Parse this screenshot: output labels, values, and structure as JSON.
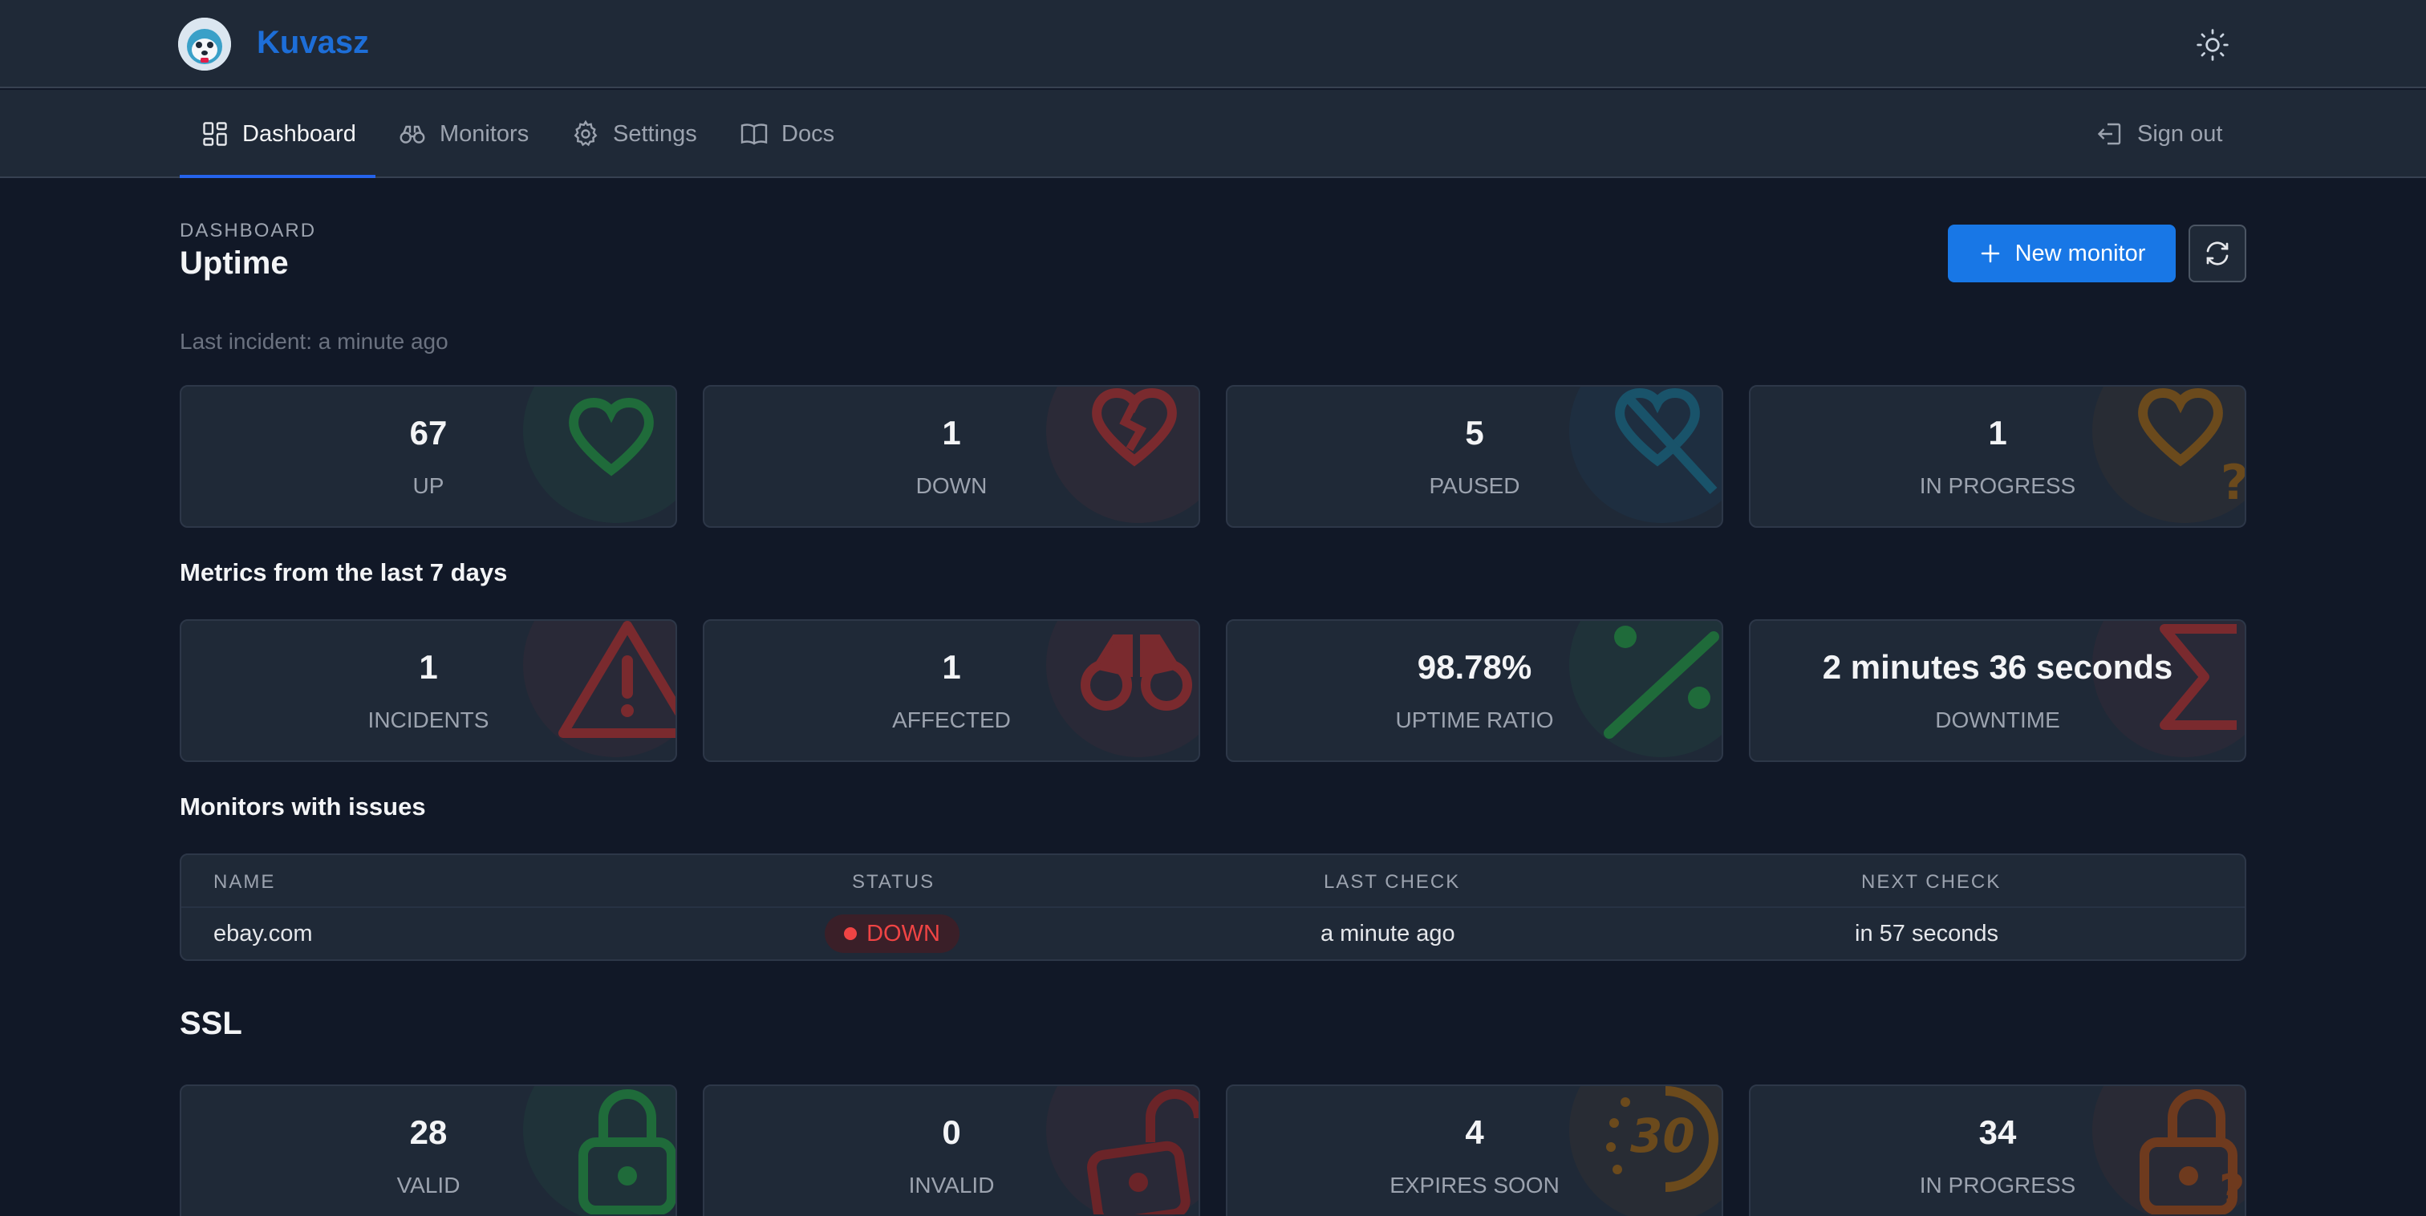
{
  "app": {
    "name": "Kuvasz"
  },
  "nav": {
    "items": [
      {
        "label": "Dashboard",
        "icon": "dashboard-icon"
      },
      {
        "label": "Monitors",
        "icon": "binoculars-icon"
      },
      {
        "label": "Settings",
        "icon": "gear-icon"
      },
      {
        "label": "Docs",
        "icon": "book-icon"
      }
    ],
    "signout": "Sign out"
  },
  "header": {
    "eyebrow": "DASHBOARD",
    "title": "Uptime",
    "last_incident": "Last incident: a minute ago",
    "new_monitor": "New monitor"
  },
  "status_cards": [
    {
      "value": "67",
      "label": "UP",
      "color": "#22c55e"
    },
    {
      "value": "1",
      "label": "DOWN",
      "color": "#ef4444"
    },
    {
      "value": "5",
      "label": "PAUSED",
      "color": "#0ea5e9"
    },
    {
      "value": "1",
      "label": "IN PROGRESS",
      "color": "#d97706"
    }
  ],
  "metrics": {
    "title": "Metrics from the last 7 days",
    "cards": [
      {
        "value": "1",
        "label": "INCIDENTS",
        "color": "#ef4444"
      },
      {
        "value": "1",
        "label": "AFFECTED",
        "color": "#ef4444"
      },
      {
        "value": "98.78%",
        "label": "UPTIME RATIO",
        "color": "#22c55e"
      },
      {
        "value": "2 minutes 36 seconds",
        "label": "DOWNTIME",
        "color": "#ef4444"
      }
    ]
  },
  "issues": {
    "title": "Monitors with issues",
    "columns": [
      "NAME",
      "STATUS",
      "LAST CHECK",
      "NEXT CHECK"
    ],
    "rows": [
      {
        "name": "ebay.com",
        "status": "DOWN",
        "last_check": "a minute ago",
        "next_check": "in 57 seconds"
      }
    ]
  },
  "ssl": {
    "title": "SSL",
    "cards": [
      {
        "value": "28",
        "label": "VALID",
        "color": "#22c55e"
      },
      {
        "value": "0",
        "label": "INVALID",
        "color": "#ef4444"
      },
      {
        "value": "4",
        "label": "EXPIRES SOON",
        "color": "#d97706"
      },
      {
        "value": "34",
        "label": "IN PROGRESS",
        "color": "#ea580c"
      }
    ]
  }
}
